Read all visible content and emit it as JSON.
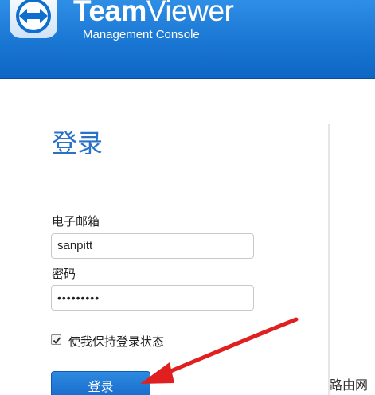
{
  "header": {
    "brand_part1": "Team",
    "brand_part2": "Viewer",
    "subtitle": "Management Console",
    "logo_icon": "teamviewer-logo-icon",
    "bg_color": "#1976d2"
  },
  "login": {
    "title": "登录",
    "email_label": "电子邮箱",
    "email_value": "sanpitt",
    "password_label": "密码",
    "password_value": "•••••••••",
    "remember_label": "使我保持登录状态",
    "remember_checked": true,
    "button_label": "登录"
  },
  "annotation": {
    "arrow_color": "#e02020"
  },
  "watermark": {
    "text": "路由网"
  }
}
